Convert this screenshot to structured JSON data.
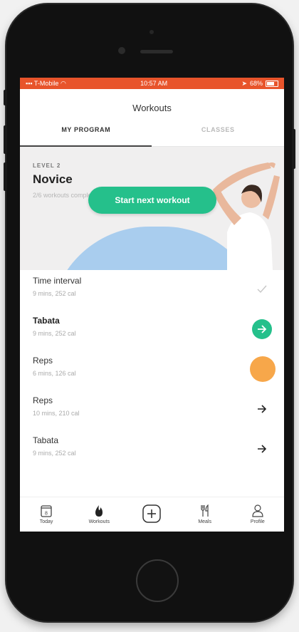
{
  "status_bar": {
    "carrier": "T-Mobile",
    "time": "10:57 AM",
    "battery": "68%"
  },
  "header": {
    "title": "Workouts"
  },
  "tabs": [
    {
      "label": "MY PROGRAM",
      "active": true
    },
    {
      "label": "CLASSES",
      "active": false
    }
  ],
  "program": {
    "level": "LEVEL 2",
    "name": "Novice",
    "progress": "2/6 workouts completed",
    "start_label": "Start next workout"
  },
  "workouts": [
    {
      "title": "Time interval",
      "meta": "9 mins, 252 cal",
      "status": "done"
    },
    {
      "title": "Tabata",
      "meta": "9 mins, 252 cal",
      "status": "next"
    },
    {
      "title": "Reps",
      "meta": "6 mins, 126 cal",
      "status": "in-progress"
    },
    {
      "title": "Reps",
      "meta": "10 mins, 210 cal",
      "status": "upcoming"
    },
    {
      "title": "Tabata",
      "meta": "9 mins, 252 cal",
      "status": "upcoming"
    }
  ],
  "nav": [
    {
      "label": "Today",
      "icon": "calendar-icon",
      "day": "8"
    },
    {
      "label": "Workouts",
      "icon": "flame-icon"
    },
    {
      "label": "",
      "icon": "plus-icon"
    },
    {
      "label": "Meals",
      "icon": "utensils-icon"
    },
    {
      "label": "Profile",
      "icon": "user-icon"
    }
  ],
  "colors": {
    "status_bar": "#e8542b",
    "accent_green": "#25c08b",
    "accent_orange": "#f7a74a",
    "arc_blue": "#a9cdee"
  }
}
